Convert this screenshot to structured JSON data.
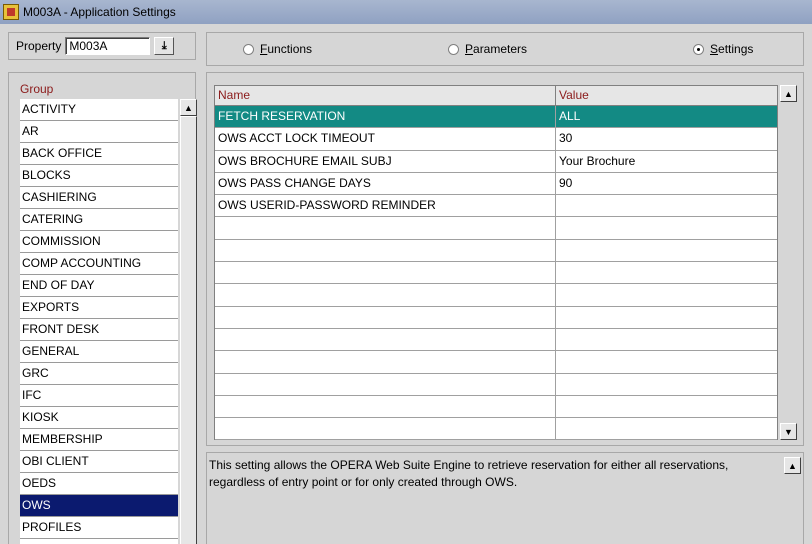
{
  "window": {
    "title": "M003A - Application Settings"
  },
  "property": {
    "label": "Property",
    "value": "M003A",
    "lov_icon": "down-arrow-underline-icon"
  },
  "mode": {
    "options": [
      {
        "label": "Functions",
        "underline": "F",
        "rest": "unctions",
        "selected": false
      },
      {
        "label": "Parameters",
        "underline": "P",
        "rest": "arameters",
        "selected": false
      },
      {
        "label": "Settings",
        "underline": "S",
        "rest": "ettings",
        "selected": true
      }
    ]
  },
  "groups": {
    "title": "Group",
    "items": [
      "ACTIVITY",
      "AR",
      "BACK OFFICE",
      "BLOCKS",
      "CASHIERING",
      "CATERING",
      "COMMISSION",
      "COMP ACCOUNTING",
      "END OF DAY",
      "EXPORTS",
      "FRONT DESK",
      "GENERAL",
      "GRC",
      "IFC",
      "KIOSK",
      "MEMBERSHIP",
      "OBI CLIENT",
      "OEDS",
      "OWS",
      "PROFILES"
    ],
    "selected": "OWS"
  },
  "settings_grid": {
    "columns": {
      "name": "Name",
      "value": "Value"
    },
    "rows": [
      {
        "name": "FETCH RESERVATION",
        "value": "ALL"
      },
      {
        "name": "OWS ACCT LOCK TIMEOUT",
        "value": "30"
      },
      {
        "name": "OWS BROCHURE EMAIL SUBJ",
        "value": "Your Brochure"
      },
      {
        "name": "OWS PASS CHANGE DAYS",
        "value": "90"
      },
      {
        "name": "OWS USERID-PASSWORD REMINDER",
        "value": ""
      },
      {
        "name": "",
        "value": ""
      },
      {
        "name": "",
        "value": ""
      },
      {
        "name": "",
        "value": ""
      },
      {
        "name": "",
        "value": ""
      },
      {
        "name": "",
        "value": ""
      },
      {
        "name": "",
        "value": ""
      },
      {
        "name": "",
        "value": ""
      },
      {
        "name": "",
        "value": ""
      },
      {
        "name": "",
        "value": ""
      },
      {
        "name": "",
        "value": ""
      }
    ],
    "selected_index": 0
  },
  "description": {
    "text": "This setting allows the OPERA Web Suite Engine to retrieve reservation for either all reservations, regardless of entry point or for only created through OWS."
  },
  "colors": {
    "group_selected": "#0b1a6f",
    "row_selected": "#138a84",
    "header_text": "#8b1a1a",
    "titlebar": "#99aacb"
  }
}
